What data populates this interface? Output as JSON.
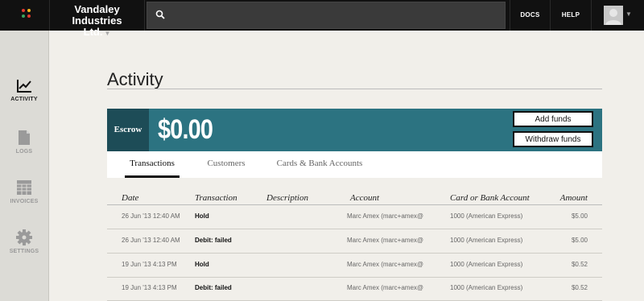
{
  "header": {
    "company_name_line1": "Vandaley Industries",
    "company_name_line2": "Ltd.",
    "search_placeholder": "",
    "docs_label": "DOCS",
    "help_label": "HELP",
    "logo_dot_colors": [
      "#e23a2f",
      "#f2b51c",
      "#3aa35f",
      "#e23a2f"
    ]
  },
  "sidebar": {
    "items": [
      {
        "label": "ACTIVITY",
        "icon": "chart-icon",
        "active": true
      },
      {
        "label": "LOGS",
        "icon": "document-icon",
        "active": false
      },
      {
        "label": "INVOICES",
        "icon": "table-icon",
        "active": false
      },
      {
        "label": "SETTINGS",
        "icon": "gear-icon",
        "active": false
      }
    ]
  },
  "main": {
    "title": "Activity",
    "escrow": {
      "label": "Escrow",
      "amount": "$0.00",
      "add_funds_label": "Add funds",
      "withdraw_funds_label": "Withdraw funds",
      "banner_color": "#2c7381"
    },
    "tabs": [
      {
        "label": "Transactions",
        "active": true
      },
      {
        "label": "Customers",
        "active": false
      },
      {
        "label": "Cards & Bank Accounts",
        "active": false
      }
    ],
    "table": {
      "headers": [
        "Date",
        "Transaction",
        "Description",
        "Account",
        "Card or Bank Account",
        "Amount"
      ],
      "rows": [
        {
          "date": "26 Jun '13 12:40 AM",
          "transaction": "Hold",
          "description": "",
          "account": "Marc Amex (marc+amex@",
          "card": "1000 (American Express)",
          "amount": "$5.00"
        },
        {
          "date": "26 Jun '13 12:40 AM",
          "transaction": "Debit: failed",
          "description": "",
          "account": "Marc Amex (marc+amex@",
          "card": "1000 (American Express)",
          "amount": "$5.00"
        },
        {
          "date": "19 Jun '13 4:13 PM",
          "transaction": "Hold",
          "description": "",
          "account": "Marc Amex (marc+amex@",
          "card": "1000 (American Express)",
          "amount": "$0.52"
        },
        {
          "date": "19 Jun '13 4:13 PM",
          "transaction": "Debit: failed",
          "description": "",
          "account": "Marc Amex (marc+amex@",
          "card": "1000 (American Express)",
          "amount": "$0.52"
        }
      ]
    }
  }
}
